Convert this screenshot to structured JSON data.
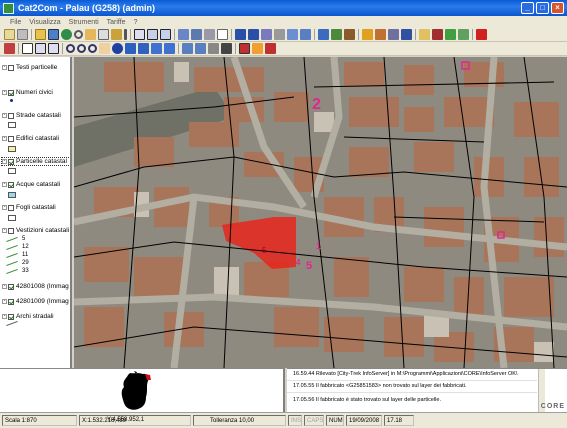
{
  "window": {
    "title": "Cat2Com - Palau (G258) (admin)"
  },
  "menu": {
    "items": [
      "File",
      "Visualizza",
      "Strumenti",
      "Tariffe",
      "?"
    ]
  },
  "layers": [
    {
      "label": "Testi particelle",
      "checked": false
    },
    {
      "label": "Numeri civici",
      "checked": true
    },
    {
      "label": "Strade catastali",
      "checked": false
    },
    {
      "label": "Edifici catastali",
      "checked": false
    },
    {
      "label": "Particelle catastal",
      "checked": true
    },
    {
      "label": "Acque catastali",
      "checked": true
    },
    {
      "label": "Fogli catastali",
      "checked": false
    },
    {
      "label": "Vestizioni catastali",
      "checked": false
    },
    {
      "label": "42801008 (Immag",
      "checked": true
    },
    {
      "label": "42801009 (Immag",
      "checked": true
    },
    {
      "label": "Archi stradali",
      "checked": true
    }
  ],
  "legend": [
    "5",
    "12",
    "11",
    "29",
    "33"
  ],
  "log": [
    "16.59.44 Rilevato [City-Trek InfoServer] in M:\\Programmi\\Applicazioni\\CORE\\InfoServer OK\\",
    "17.05.55 Il fabbricato <G25851583> non trovato sul layer dei fabbricati.",
    "17.05.56 Il fabbricato è stato trovato sul layer delle particelle."
  ],
  "logo": "CORE",
  "status": {
    "scale": "Scala 1:870",
    "x": "X:1.532.216,489",
    "y": "Y:4.558.952,1",
    "tolerance": "Tolleranza 10,00",
    "ins": "INS",
    "caps": "CAPS",
    "num": "NUM",
    "date": "19/09/2008",
    "time": "17.18"
  },
  "map_labels": [
    "2",
    "1",
    "5",
    "4",
    "5"
  ],
  "colors": {
    "selection": "#e8241c",
    "highlight_text": "#e0288c",
    "parcel_lines": "#000000"
  }
}
